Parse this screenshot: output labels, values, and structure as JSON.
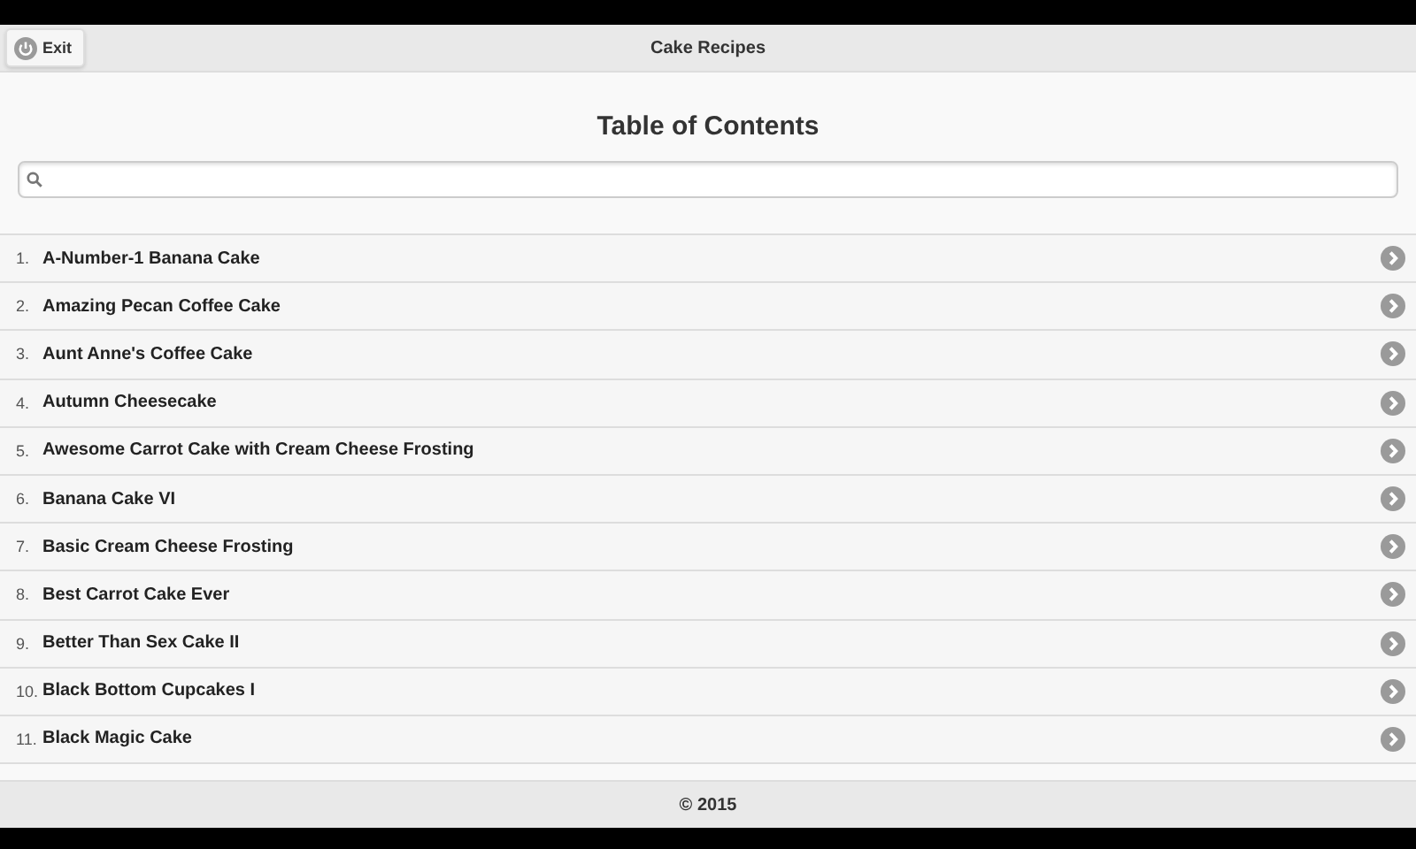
{
  "header": {
    "exit_label": "Exit",
    "title": "Cake Recipes"
  },
  "heading": "Table of Contents",
  "recipes": [
    {
      "number": "1.",
      "name": "A-Number-1 Banana Cake"
    },
    {
      "number": "2.",
      "name": "Amazing Pecan Coffee Cake"
    },
    {
      "number": "3.",
      "name": "Aunt Anne's Coffee Cake"
    },
    {
      "number": "4.",
      "name": "Autumn Cheesecake"
    },
    {
      "number": "5.",
      "name": "Awesome Carrot Cake with Cream Cheese Frosting"
    },
    {
      "number": "6.",
      "name": "Banana Cake VI"
    },
    {
      "number": "7.",
      "name": "Basic Cream Cheese Frosting"
    },
    {
      "number": "8.",
      "name": "Best Carrot Cake Ever"
    },
    {
      "number": "9.",
      "name": "Better Than Sex Cake II"
    },
    {
      "number": "10.",
      "name": "Black Bottom Cupcakes I"
    },
    {
      "number": "11.",
      "name": "Black Magic Cake"
    }
  ],
  "footer": "© 2015"
}
